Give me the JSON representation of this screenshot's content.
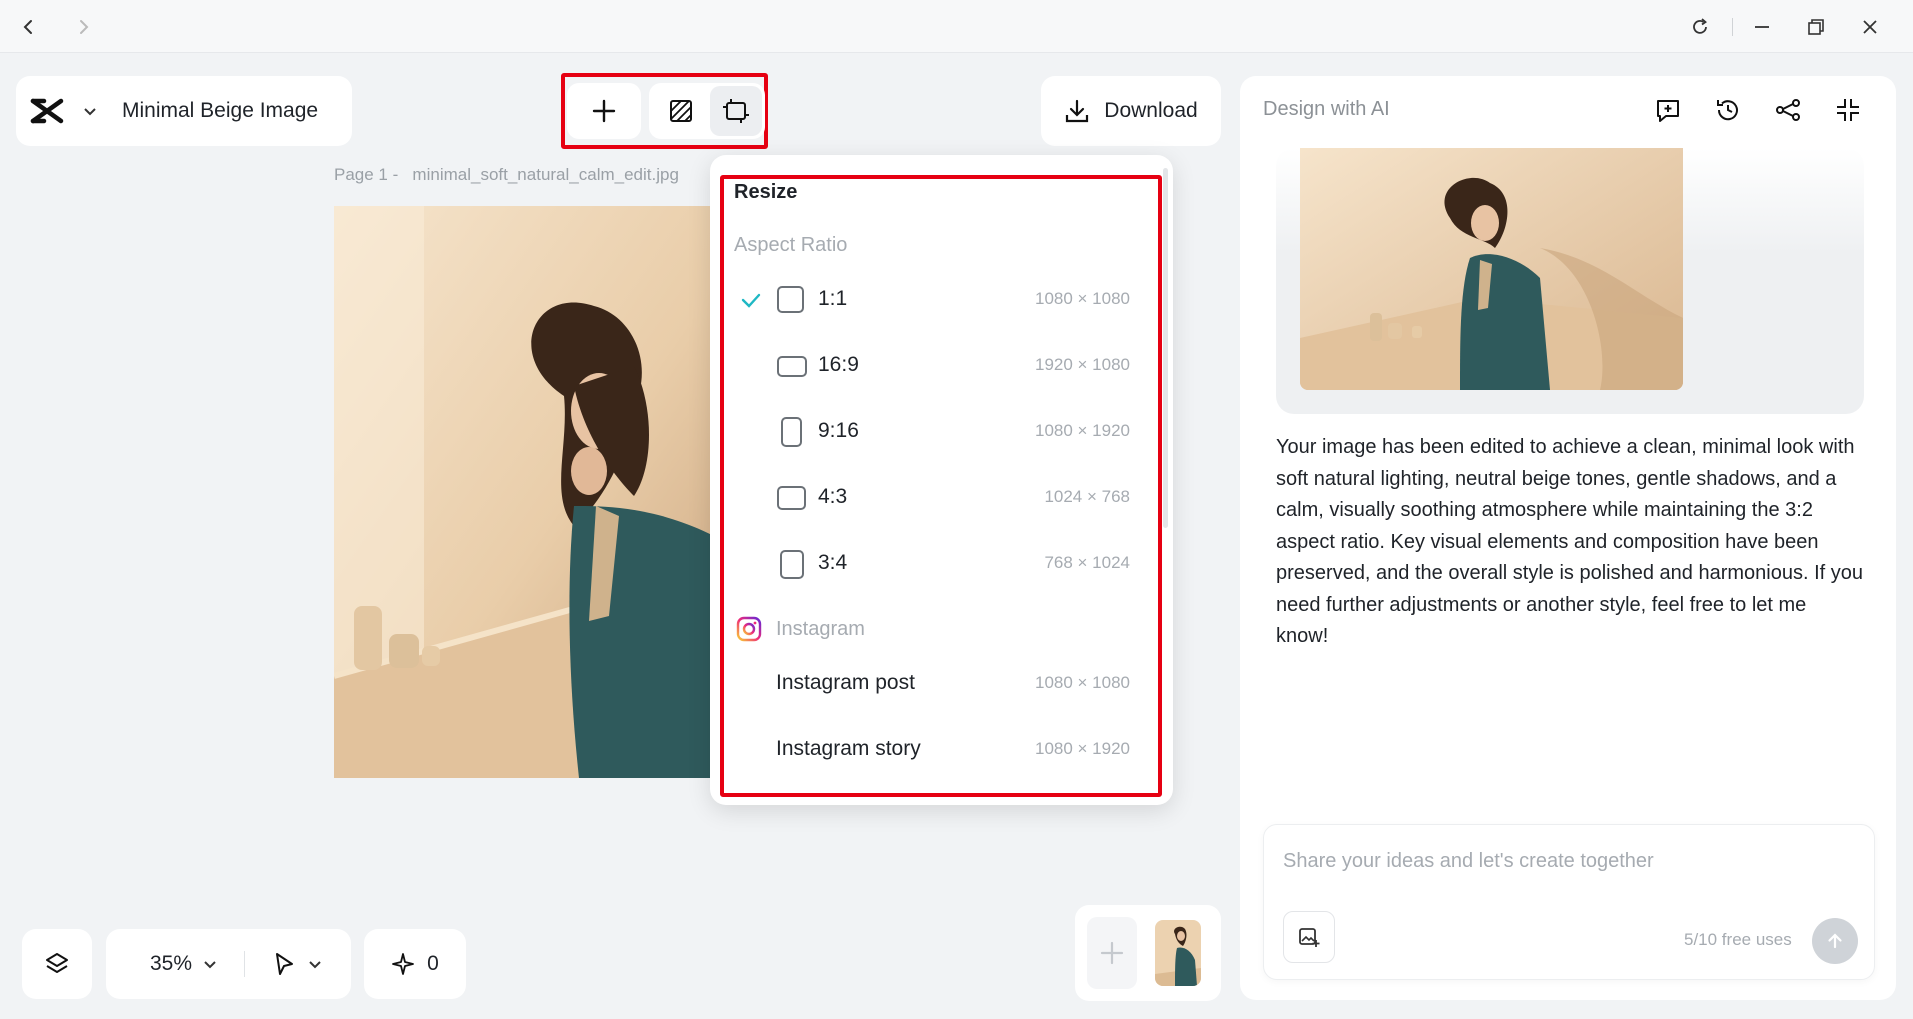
{
  "document": {
    "title": "Minimal Beige Image"
  },
  "toolbar": {
    "download_label": "Download"
  },
  "canvas": {
    "page_label": "Page 1 -   minimal_soft_natural_calm_edit.jpg"
  },
  "resize_menu": {
    "title": "Resize",
    "aspect_heading": "Aspect Ratio",
    "ratios": [
      {
        "label": "1:1",
        "dims": "1080 × 1080",
        "selected": true
      },
      {
        "label": "16:9",
        "dims": "1920 × 1080",
        "selected": false
      },
      {
        "label": "9:16",
        "dims": "1080 × 1920",
        "selected": false
      },
      {
        "label": "4:3",
        "dims": "1024 × 768",
        "selected": false
      },
      {
        "label": "3:4",
        "dims": "768 × 1024",
        "selected": false
      }
    ],
    "instagram_heading": "Instagram",
    "instagram": [
      {
        "label": "Instagram post",
        "dims": "1080 × 1080"
      },
      {
        "label": "Instagram story",
        "dims": "1080 × 1920"
      }
    ]
  },
  "ai_panel": {
    "title": "Design with AI",
    "message": "Your image has been edited to achieve a clean, minimal look with soft natural lighting, neutral beige tones, gentle shadows, and a calm, visually soothing atmosphere while maintaining the 3:2 aspect ratio. Key visual elements and composition have been preserved, and the overall style is polished and harmonious. If you need further adjustments or another style, feel free to let me know!",
    "prompt_placeholder": "Share your ideas and let's create together",
    "free_uses": "5/10 free uses"
  },
  "bottom": {
    "zoom": "35%",
    "credits": "0"
  },
  "colors": {
    "accent_check": "#1fb8c4",
    "highlight_frame": "#e60012",
    "instagram_gradient": [
      "#f9ce34",
      "#ee2a7b",
      "#6228d7"
    ]
  }
}
